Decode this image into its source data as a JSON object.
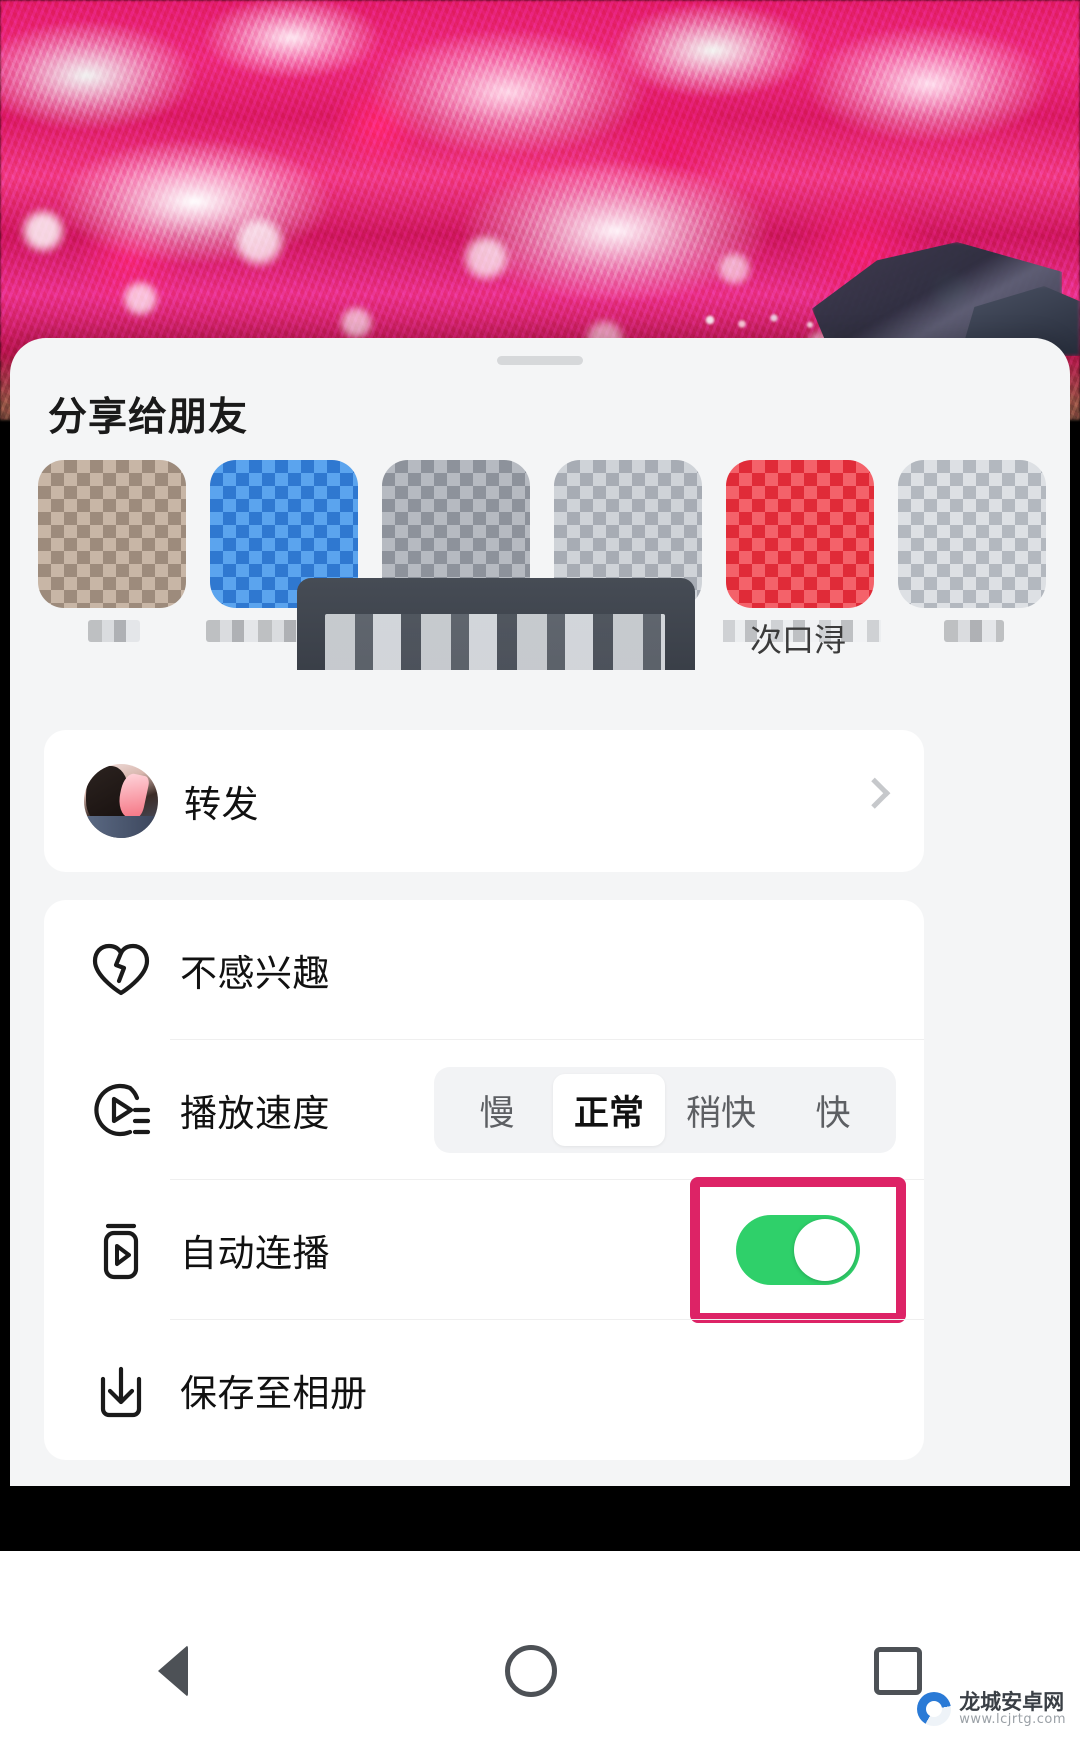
{
  "background": {
    "description": "plum-blossom-orchard-photo",
    "pavilion": "traditional-pavilion-roof"
  },
  "sheet": {
    "title": "分享给朋友",
    "grabber": "drag-handle"
  },
  "contacts": {
    "items": [
      {
        "name": "",
        "blurred": true,
        "avatar": "px-a",
        "name_width": 52
      },
      {
        "name": "",
        "blurred": true,
        "avatar": "px-b",
        "name_width": 160
      },
      {
        "name": "",
        "blurred": true,
        "avatar": "px-c",
        "name_width": 142
      },
      {
        "name": "",
        "blurred": true,
        "avatar": "px-d",
        "name_width": 106
      },
      {
        "name": "次口浔",
        "blurred": true,
        "avatar": "px-e",
        "name_width": 158
      },
      {
        "name": "",
        "blurred": true,
        "avatar": "px-f",
        "name_width": 60
      }
    ]
  },
  "forward": {
    "label": "转发",
    "avatar": "user-avatar",
    "chevron": "chevron-right-icon"
  },
  "settings": {
    "rows": [
      {
        "label": "不感兴趣",
        "icon": "broken-heart-icon",
        "control": "none"
      },
      {
        "label": "播放速度",
        "icon": "playback-speed-icon",
        "control": "segmented"
      },
      {
        "label": "自动连播",
        "icon": "auto-play-icon",
        "control": "toggle"
      },
      {
        "label": "保存至相册",
        "icon": "download-icon",
        "control": "none"
      }
    ],
    "speed_options": [
      {
        "label": "慢",
        "selected": false
      },
      {
        "label": "正常",
        "selected": true
      },
      {
        "label": "稍快",
        "selected": false
      },
      {
        "label": "快",
        "selected": false
      }
    ],
    "autoplay": {
      "state": "on",
      "highlighted": true
    }
  },
  "colors": {
    "highlight": "#dd2366",
    "toggle_on": "#2fd06a",
    "sheet_bg": "#f4f5f6",
    "card_bg": "#ffffff",
    "text_primary": "#111111",
    "text_secondary": "#5d5f63"
  },
  "navbar": {
    "back": "back-triangle-icon",
    "home": "home-circle-icon",
    "recents": "recents-square-icon"
  },
  "watermark": {
    "name": "龙城安卓网",
    "url": "www.lcjrtg.com"
  }
}
